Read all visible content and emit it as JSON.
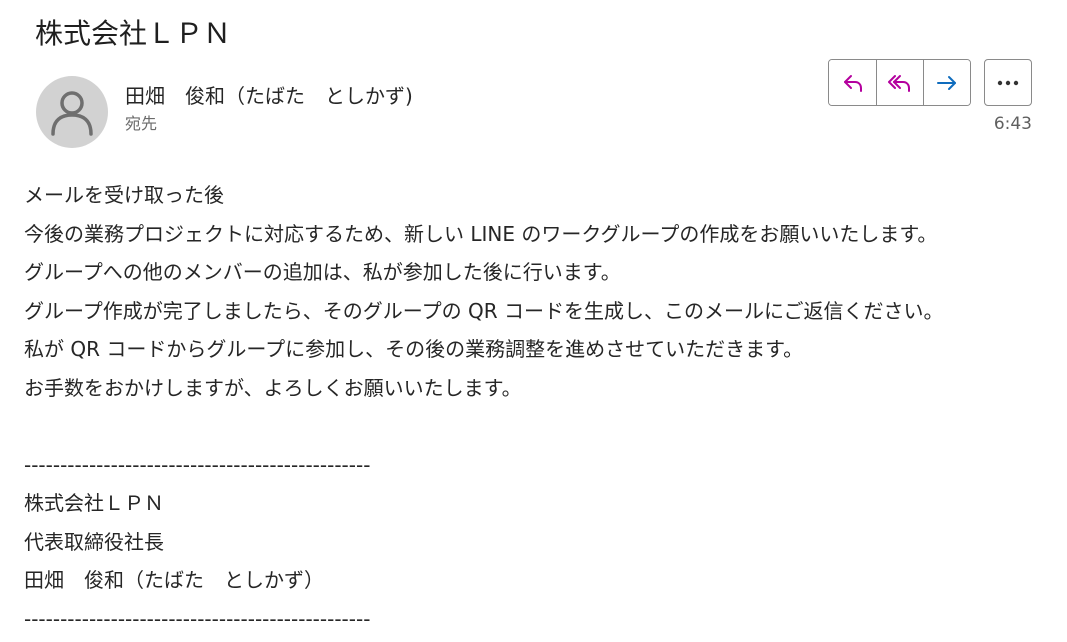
{
  "email": {
    "subject": "株式会社ＬＰＮ",
    "sender_name": "田畑　俊和（たばた　としかず)",
    "recipient_label": "宛先",
    "time": "6:43",
    "actions": {
      "reply_icon": "reply-icon",
      "reply_all_icon": "reply-all-icon",
      "forward_icon": "forward-icon",
      "more_icon": "more-icon"
    },
    "body_lines": [
      "メールを受け取った後",
      "今後の業務プロジェクトに対応するため、新しい LINE のワークグループの作成をお願いいたします。",
      "グループへの他のメンバーの追加は、私が参加した後に行います。",
      "グループ作成が完了しましたら、そのグループの QR コードを生成し、このメールにご返信ください。",
      "私が QR コードからグループに参加し、その後の業務調整を進めさせていただきます。",
      "お手数をおかけしますが、よろしくお願いいたします。"
    ],
    "signature": {
      "separator_top": "------------------------------------------------",
      "company": "株式会社ＬＰＮ",
      "title": "代表取締役社長",
      "name": "田畑　俊和（たばた　としかず）",
      "separator_bottom": "------------------------------------------------"
    }
  },
  "colors": {
    "reply_purple": "#b4009e",
    "forward_blue": "#0f6cbd",
    "border": "#8a8a8a",
    "avatar_bg": "#d2d2d2"
  }
}
